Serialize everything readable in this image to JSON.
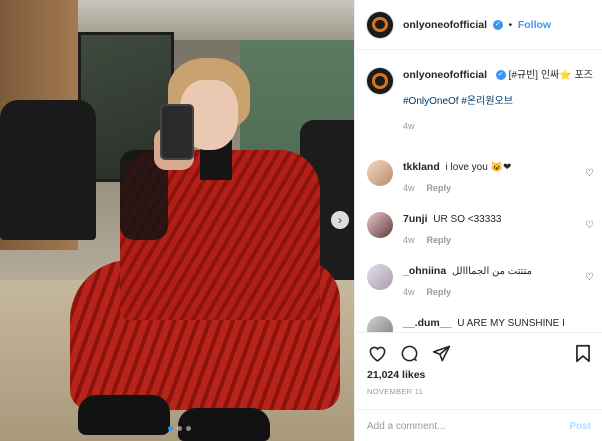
{
  "colors": {
    "accent": "#3897f0",
    "text": "#262626",
    "muted": "#999999"
  },
  "post": {
    "username": "onlyoneofofficial",
    "follow_label": "Follow",
    "separator": "•",
    "caption_text": "[#규빈] 인싸",
    "caption_emoji": "⭐",
    "caption_tail": "포즈",
    "hashtags": "#OnlyOneOf #온리원오브",
    "age": "4w"
  },
  "comments": [
    {
      "username": "tkkland",
      "text": "i love you",
      "emoji": "😺❤",
      "age": "4w",
      "reply_label": "Reply"
    },
    {
      "username": "7unji",
      "text": "UR SO <33333",
      "emoji": "",
      "age": "4w",
      "reply_label": "Reply"
    },
    {
      "username": "_ohniina",
      "text": "متتتت من الجمااالل",
      "emoji": "",
      "age": "4w",
      "reply_label": "Reply"
    },
    {
      "username": "__.dum__",
      "text": "U ARE MY SUNSHINE I",
      "emoji": "",
      "age": "",
      "reply_label": ""
    }
  ],
  "actions": {
    "like_icon": "heart-icon",
    "comment_icon": "comment-icon",
    "share_icon": "share-icon",
    "save_icon": "bookmark-icon"
  },
  "likes": "21,024 likes",
  "date": "NOVEMBER 11",
  "add_comment": {
    "placeholder": "Add a comment...",
    "post_label": "Post"
  },
  "carousel": {
    "next_icon": "chevron-right-icon",
    "current_slide": 1,
    "total_slides": 3
  }
}
